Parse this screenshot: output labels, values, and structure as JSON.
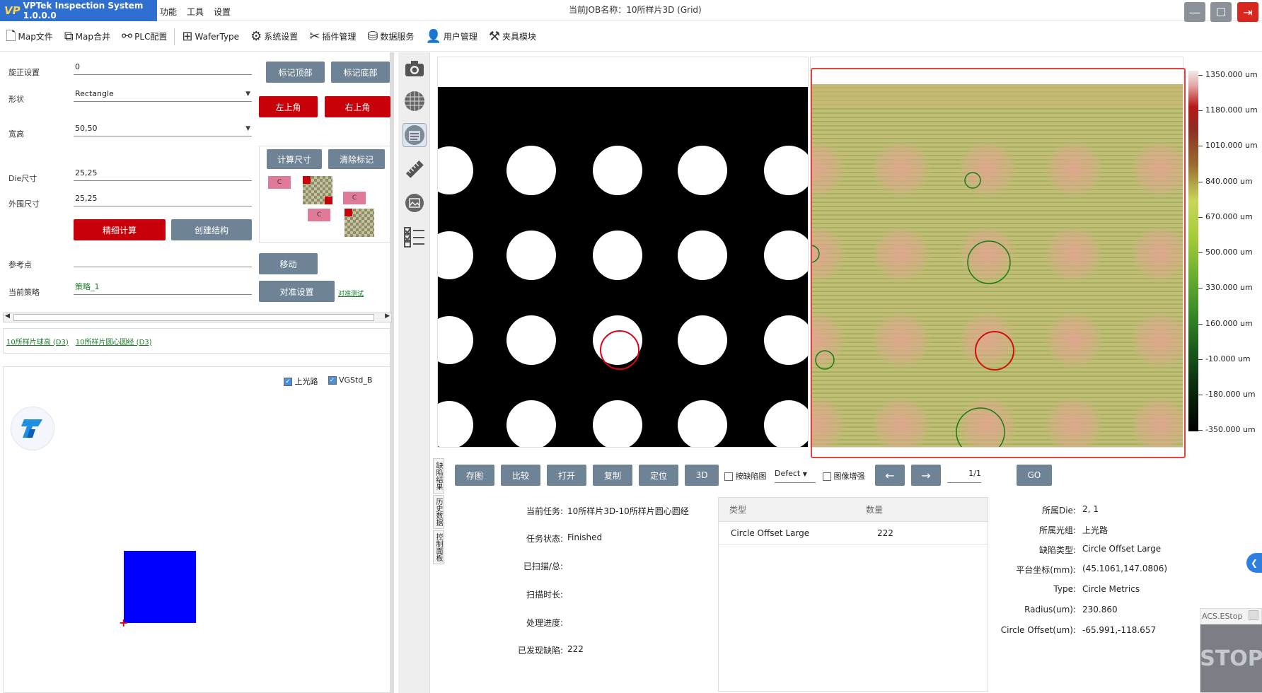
{
  "titlebar": {
    "app_name": "VPTek Inspection System 1.0.0.0",
    "menus": [
      "功能",
      "工具",
      "设置"
    ],
    "job_title": "当前JOB名称：10所样片3D (Grid)"
  },
  "toolbar": {
    "items": [
      {
        "label": "Map文件",
        "icon": "file-icon"
      },
      {
        "label": "Map合并",
        "icon": "merge-icon"
      },
      {
        "label": "PLC配置",
        "icon": "plc-icon"
      },
      {
        "label": "WaferType",
        "icon": "grid-icon"
      },
      {
        "label": "系统设置",
        "icon": "gear-icon"
      },
      {
        "label": "插件管理",
        "icon": "tools-icon"
      },
      {
        "label": "数据服务",
        "icon": "database-icon"
      },
      {
        "label": "用户管理",
        "icon": "user-icon"
      },
      {
        "label": "夹具模块",
        "icon": "fixture-icon"
      }
    ]
  },
  "left": {
    "rotation_label": "旋正设置",
    "rotation_value": "0",
    "mark_top": "标记顶部",
    "mark_bottom": "标记底部",
    "shape_label": "形状",
    "shape_value": "Rectangle",
    "top_left": "左上角",
    "top_right": "右上角",
    "size_label": "宽高",
    "size_value": "50,50",
    "calc_size": "计算尺寸",
    "clear_marks": "清除标记",
    "die_label": "Die尺寸",
    "die_value": "25,25",
    "outer_label": "外围尺寸",
    "outer_value": "25,25",
    "chip_label": "C",
    "fine_calc": "精细计算",
    "create_struct": "创建结构",
    "ref_label": "参考点",
    "ref_value": "",
    "move": "移动",
    "strategy_label": "当前策略",
    "strategy_value": "策略_1",
    "align_settings": "对准设置",
    "align_test": "对准测试",
    "tab_links": [
      "10所样片球高 (D3)",
      "10所样片圆心圆经 (D3)"
    ],
    "check_top_light": "上光路",
    "check_vgstd": "VGStd_B"
  },
  "vtabs": [
    "缺陷结果",
    "历史数据",
    "控制面板"
  ],
  "colorbar_ticks": [
    "1350.000 um",
    "1180.000 um",
    "1010.000 um",
    "840.000 um",
    "670.000 um",
    "500.000 um",
    "330.000 um",
    "160.000 um",
    "-10.000 um",
    "-180.000 um",
    "-350.000 um"
  ],
  "bottom": {
    "save_img": "存图",
    "compare": "比较",
    "open": "打开",
    "copy": "复制",
    "locate": "定位",
    "btn_3d": "3D",
    "by_defect_label": "按缺陷图",
    "defect_select": "Defect",
    "enhance_label": "图像增强",
    "prev": "←",
    "next": "→",
    "page": "1/1",
    "go": "GO"
  },
  "task": {
    "current_task_label": "当前任务:",
    "current_task_value": "10所样片3D-10所样片圆心圆经",
    "status_label": "任务状态:",
    "status_value": "Finished",
    "scanned_label": "已扫描/总:",
    "scanned_value": "",
    "scan_time_label": "扫描时长:",
    "scan_time_value": "",
    "progress_label": "处理进度:",
    "progress_value": "",
    "found_label": "已发现缺陷:",
    "found_value": "222"
  },
  "defect_table": {
    "col_type": "类型",
    "col_count": "数量",
    "rows": [
      {
        "type": "Circle Offset Large",
        "count": "222"
      }
    ]
  },
  "detail": {
    "die_label": "所属Die:",
    "die_value": "2, 1",
    "group_label": "所属光组:",
    "group_value": "上光路",
    "defect_type_label": "缺陷类型:",
    "defect_type_value": "Circle Offset Large",
    "stage_label": "平台坐标(mm):",
    "stage_value": "(45.1061,147.0806)",
    "type_label": "Type:",
    "type_value": "Circle Metrics",
    "radius_label": "Radius(um):",
    "radius_value": "230.860",
    "offset_label": "Circle Offset(um):",
    "offset_value": "-65.991,-118.657"
  },
  "estop": {
    "label": "ACS.EStop",
    "sign": "STOP"
  },
  "colors": {
    "accent_red": "#c8000a",
    "button_grey": "#6e8496",
    "brand_blue": "#2f6fd0",
    "frame_red": "#e0443a"
  }
}
